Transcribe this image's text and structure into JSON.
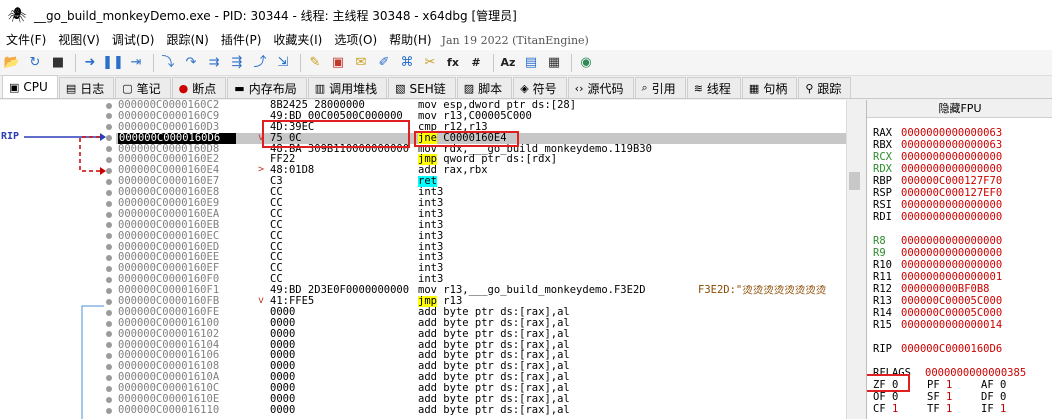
{
  "window": {
    "title": "__go_build_monkeyDemo.exe - PID: 30344 - 线程: 主线程 30348 - x64dbg [管理员]"
  },
  "menu": {
    "items": [
      "文件(F)",
      "视图(V)",
      "调试(D)",
      "跟踪(N)",
      "插件(P)",
      "收藏夹(I)",
      "选项(O)",
      "帮助(H)"
    ],
    "build_info": "Jan 19 2022 (TitanEngine)"
  },
  "toolbar": {
    "text_buttons": {
      "fx": "fx",
      "hash": "#",
      "az": "Aᴢ"
    }
  },
  "tabs": [
    {
      "label": "CPU",
      "icon": "cpu-icon"
    },
    {
      "label": "日志",
      "icon": "log-icon"
    },
    {
      "label": "笔记",
      "icon": "notes-icon"
    },
    {
      "label": "断点",
      "icon": "breakpoint-icon"
    },
    {
      "label": "内存布局",
      "icon": "memory-icon"
    },
    {
      "label": "调用堆栈",
      "icon": "callstack-icon"
    },
    {
      "label": "SEH链",
      "icon": "seh-icon"
    },
    {
      "label": "脚本",
      "icon": "script-icon"
    },
    {
      "label": "符号",
      "icon": "symbol-icon"
    },
    {
      "label": "源代码",
      "icon": "source-icon"
    },
    {
      "label": "引用",
      "icon": "reference-icon"
    },
    {
      "label": "线程",
      "icon": "thread-icon"
    },
    {
      "label": "句柄",
      "icon": "handle-icon"
    },
    {
      "label": "跟踪",
      "icon": "trace-icon"
    }
  ],
  "cpu": {
    "rip_label": "RIP",
    "current_index": 3,
    "rows": [
      {
        "addr": "000000C0000160C2",
        "bytes": "8B2425 28000000",
        "mnemonic": "mov",
        "operands": "esp,dword ptr ds:[28]",
        "hl": "",
        "comment": "",
        "jump": ""
      },
      {
        "addr": "000000C0000160C9",
        "bytes": "49:BD 00C00500C000000",
        "mnemonic": "mov",
        "operands": "r13,C00005C000",
        "hl": "",
        "comment": "",
        "jump": ""
      },
      {
        "addr": "000000C0000160D3",
        "bytes": "4D:39EC",
        "mnemonic": "cmp",
        "operands": "r12,r13",
        "hl": "",
        "comment": "",
        "jump": ""
      },
      {
        "addr": "000000C0000160D6",
        "bytes": "75 0C",
        "mnemonic": "jne",
        "operands": "C0000160E4",
        "hl": "jmp",
        "comment": "",
        "jump": "v"
      },
      {
        "addr": "000000C0000160D8",
        "bytes": "48:BA 309B110000000000",
        "mnemonic": "mov",
        "operands": "rdx,___go_build_monkeydemo.119B30",
        "hl": "",
        "comment": "",
        "jump": ""
      },
      {
        "addr": "000000C0000160E2",
        "bytes": "FF22",
        "mnemonic": "jmp",
        "operands": "qword ptr ds:[rdx]",
        "hl": "jmp",
        "comment": "",
        "jump": ""
      },
      {
        "addr": "000000C0000160E4",
        "bytes": "48:01D8",
        "mnemonic": "add",
        "operands": "rax,rbx",
        "hl": "",
        "comment": "",
        "jump": ">"
      },
      {
        "addr": "000000C0000160E7",
        "bytes": "C3",
        "mnemonic": "ret",
        "operands": "",
        "hl": "ret",
        "comment": "",
        "jump": ""
      },
      {
        "addr": "000000C0000160E8",
        "bytes": "CC",
        "mnemonic": "int3",
        "operands": "",
        "hl": "",
        "comment": "",
        "jump": ""
      },
      {
        "addr": "000000C0000160E9",
        "bytes": "CC",
        "mnemonic": "int3",
        "operands": "",
        "hl": "",
        "comment": "",
        "jump": ""
      },
      {
        "addr": "000000C0000160EA",
        "bytes": "CC",
        "mnemonic": "int3",
        "operands": "",
        "hl": "",
        "comment": "",
        "jump": ""
      },
      {
        "addr": "000000C0000160EB",
        "bytes": "CC",
        "mnemonic": "int3",
        "operands": "",
        "hl": "",
        "comment": "",
        "jump": ""
      },
      {
        "addr": "000000C0000160EC",
        "bytes": "CC",
        "mnemonic": "int3",
        "operands": "",
        "hl": "",
        "comment": "",
        "jump": ""
      },
      {
        "addr": "000000C0000160ED",
        "bytes": "CC",
        "mnemonic": "int3",
        "operands": "",
        "hl": "",
        "comment": "",
        "jump": ""
      },
      {
        "addr": "000000C0000160EE",
        "bytes": "CC",
        "mnemonic": "int3",
        "operands": "",
        "hl": "",
        "comment": "",
        "jump": ""
      },
      {
        "addr": "000000C0000160EF",
        "bytes": "CC",
        "mnemonic": "int3",
        "operands": "",
        "hl": "",
        "comment": "",
        "jump": ""
      },
      {
        "addr": "000000C0000160F0",
        "bytes": "CC",
        "mnemonic": "int3",
        "operands": "",
        "hl": "",
        "comment": "",
        "jump": ""
      },
      {
        "addr": "000000C0000160F1",
        "bytes": "49:BD 2D3E0F0000000000",
        "mnemonic": "mov",
        "operands": "r13,___go_build_monkeydemo.F3E2D",
        "hl": "",
        "comment": "F3E2D:\"烫烫烫烫烫烫烫烫",
        "jump": ""
      },
      {
        "addr": "000000C0000160FB",
        "bytes": "41:FFE5",
        "mnemonic": "jmp",
        "operands": "r13",
        "hl": "jmp",
        "comment": "",
        "jump": "v"
      },
      {
        "addr": "000000C0000160FE",
        "bytes": "0000",
        "mnemonic": "add",
        "operands": "byte ptr ds:[rax],al",
        "hl": "",
        "comment": "",
        "jump": ""
      },
      {
        "addr": "000000C000016100",
        "bytes": "0000",
        "mnemonic": "add",
        "operands": "byte ptr ds:[rax],al",
        "hl": "",
        "comment": "",
        "jump": ""
      },
      {
        "addr": "000000C000016102",
        "bytes": "0000",
        "mnemonic": "add",
        "operands": "byte ptr ds:[rax],al",
        "hl": "",
        "comment": "",
        "jump": ""
      },
      {
        "addr": "000000C000016104",
        "bytes": "0000",
        "mnemonic": "add",
        "operands": "byte ptr ds:[rax],al",
        "hl": "",
        "comment": "",
        "jump": ""
      },
      {
        "addr": "000000C000016106",
        "bytes": "0000",
        "mnemonic": "add",
        "operands": "byte ptr ds:[rax],al",
        "hl": "",
        "comment": "",
        "jump": ""
      },
      {
        "addr": "000000C000016108",
        "bytes": "0000",
        "mnemonic": "add",
        "operands": "byte ptr ds:[rax],al",
        "hl": "",
        "comment": "",
        "jump": ""
      },
      {
        "addr": "000000C00001610A",
        "bytes": "0000",
        "mnemonic": "add",
        "operands": "byte ptr ds:[rax],al",
        "hl": "",
        "comment": "",
        "jump": ""
      },
      {
        "addr": "000000C00001610C",
        "bytes": "0000",
        "mnemonic": "add",
        "operands": "byte ptr ds:[rax],al",
        "hl": "",
        "comment": "",
        "jump": ""
      },
      {
        "addr": "000000C00001610E",
        "bytes": "0000",
        "mnemonic": "add",
        "operands": "byte ptr ds:[rax],al",
        "hl": "",
        "comment": "",
        "jump": ""
      },
      {
        "addr": "000000C000016110",
        "bytes": "0000",
        "mnemonic": "add",
        "operands": "byte ptr ds:[rax],al",
        "hl": "",
        "comment": "",
        "jump": ""
      }
    ]
  },
  "registers": {
    "header": "隐藏FPU",
    "gp": [
      {
        "name": "RAX",
        "value": "0000000000000063",
        "highlight": false
      },
      {
        "name": "RBX",
        "value": "0000000000000063",
        "highlight": false
      },
      {
        "name": "RCX",
        "value": "0000000000000000",
        "highlight": true
      },
      {
        "name": "RDX",
        "value": "0000000000000000",
        "highlight": true
      },
      {
        "name": "RBP",
        "value": "000000C000127F70",
        "highlight": false
      },
      {
        "name": "RSP",
        "value": "000000C000127EF0",
        "highlight": false
      },
      {
        "name": "RSI",
        "value": "0000000000000000",
        "highlight": false
      },
      {
        "name": "RDI",
        "value": "0000000000000000",
        "highlight": false
      }
    ],
    "ext": [
      {
        "name": "R8",
        "value": "0000000000000000",
        "highlight": true
      },
      {
        "name": "R9",
        "value": "0000000000000000",
        "highlight": true
      },
      {
        "name": "R10",
        "value": "0000000000000000",
        "highlight": false
      },
      {
        "name": "R11",
        "value": "0000000000000001",
        "highlight": false
      },
      {
        "name": "R12",
        "value": "000000000BF0B8",
        "highlight": false
      },
      {
        "name": "R13",
        "value": "000000C00005C000",
        "highlight": false
      },
      {
        "name": "R14",
        "value": "000000C00005C000",
        "highlight": false
      },
      {
        "name": "R15",
        "value": "0000000000000014",
        "highlight": false
      }
    ],
    "rip": {
      "name": "RIP",
      "value": "000000C0000160D6"
    },
    "rflags": {
      "name": "RFLAGS",
      "value": "0000000000000385"
    },
    "flag_rows": [
      [
        {
          "name": "ZF",
          "value": "0",
          "on": false
        },
        {
          "name": "PF",
          "value": "1",
          "on": true
        },
        {
          "name": "AF",
          "value": "0",
          "on": false
        }
      ],
      [
        {
          "name": "OF",
          "value": "0",
          "on": false
        },
        {
          "name": "SF",
          "value": "1",
          "on": true
        },
        {
          "name": "DF",
          "value": "0",
          "on": false
        }
      ],
      [
        {
          "name": "CF",
          "value": "1",
          "on": true
        },
        {
          "name": "TF",
          "value": "1",
          "on": true
        },
        {
          "name": "IF",
          "value": "1",
          "on": true
        }
      ]
    ]
  },
  "colors": {
    "current_row_bg": "#c7c7c7",
    "jmp_highlight": "#ffff00",
    "ret_highlight": "#00ffff",
    "register_value": "#cc0000",
    "annotation_box": "#e02020",
    "rip_arrow": "#2c3db9"
  }
}
